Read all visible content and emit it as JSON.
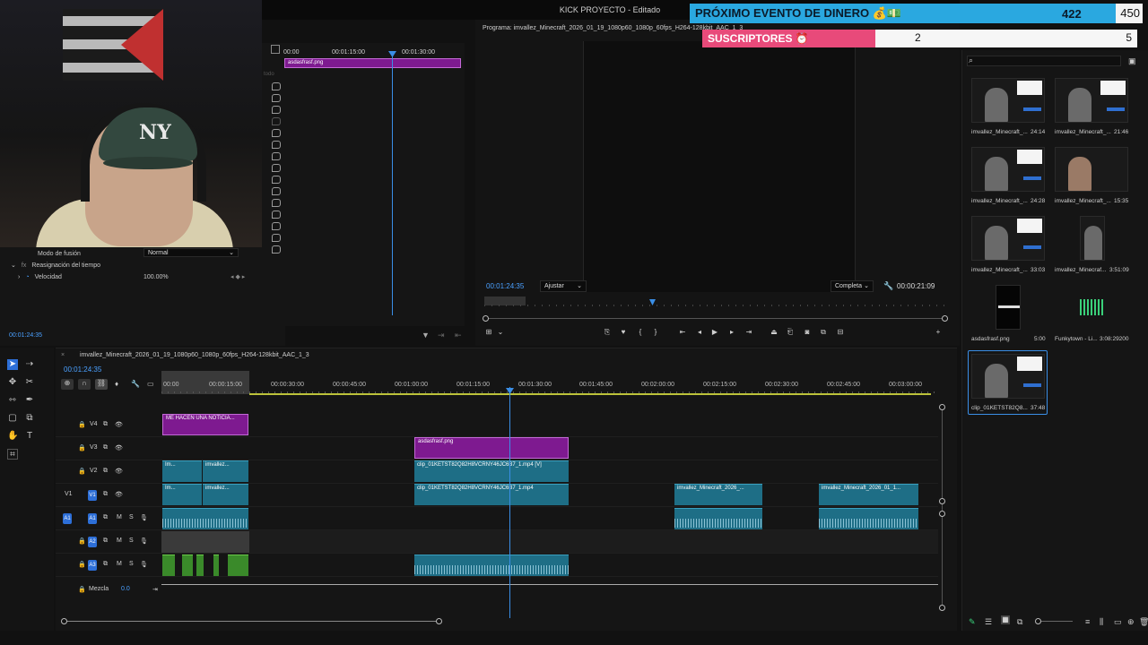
{
  "title": "KICK PROYECTO - Editado",
  "overlay": {
    "event_label": "PRÓXIMO EVENTO DE DINERO 💰💵",
    "event_count": "422",
    "event_goal": "450",
    "subs_label": "SUSCRIPTORES ⏰",
    "subs_count": "2",
    "subs_goal": "5"
  },
  "effect_controls": {
    "blend_label": "Modo de fusión",
    "blend_value": "Normal",
    "time_remap_label": "Reasignación del tiempo",
    "speed_label": "Velocidad",
    "speed_value": "100.00%",
    "timecode": "00:01:24:35"
  },
  "source": {
    "ruler": [
      "00:00",
      "00:01:15:00",
      "00:01:30:00"
    ],
    "clip_label": "asdasfrasf.png",
    "side_label": "todo"
  },
  "program": {
    "label": "Programa: imvallez_Minecraft_2026_01_19_1080p60_1080p_60fps_H264-128kbit_AAC_1_3",
    "timecode": "00:01:24:35",
    "fit_label": "Ajustar",
    "quality_label": "Completa",
    "duration": "00:00:21:09"
  },
  "bin": {
    "items": [
      {
        "name": "imvallez_Minecraft_...",
        "duration": "24:14"
      },
      {
        "name": "imvallez_Minecraft_...",
        "duration": "21:46"
      },
      {
        "name": "imvallez_Minecraft_...",
        "duration": "24:28"
      },
      {
        "name": "imvallez_Minecraft_...",
        "duration": "15:35"
      },
      {
        "name": "imvallez_Minecraft_...",
        "duration": "33:03"
      },
      {
        "name": "imvallez_Minecraf...",
        "duration": "3:51:09"
      },
      {
        "name": "asdasfrasf.png",
        "duration": "5:00"
      },
      {
        "name": "Funkytown - Li...",
        "duration": "3:08:29200"
      },
      {
        "name": "clip_01KETST82Q8...",
        "duration": "37:48"
      }
    ]
  },
  "timeline": {
    "sequence_name": "imvallez_Minecraft_2026_01_19_1080p60_1080p_60fps_H264-128kbit_AAC_1_3",
    "timecode": "00:01:24:35",
    "ruler": [
      "00:00",
      "00:00:15:00",
      "00:00:30:00",
      "00:00:45:00",
      "00:01:00:00",
      "00:01:15:00",
      "00:01:30:00",
      "00:01:45:00",
      "00:02:00:00",
      "00:02:15:00",
      "00:02:30:00",
      "00:02:45:00",
      "00:03:00:00"
    ],
    "tracks": {
      "v4": "V4",
      "v3": "V3",
      "v2": "V2",
      "v1": "V1",
      "v1_src": "V1",
      "a1": "A1",
      "a1_src": "A1",
      "a2": "A2",
      "a3": "A3",
      "m": "M",
      "s": "S",
      "mix_label": "Mezcla",
      "mix_value": "0.0"
    },
    "clips": {
      "v4_title": "ME HACEN UNA NOTICIA...",
      "v3_png": "asdasfrasf.png",
      "v2_a": "Im...",
      "v2_b": "imvallez...",
      "v2_clip": "clip_01KETST82Q82H8VCRNY46JC6B7_1.mp4 [V]",
      "v1_a": "Im...",
      "v1_b": "imvallez...",
      "v1_clip": "clip_01KETST82Q82H8VCRNY46JC6B7_1.mp4",
      "v1_c": "imvallez_Minecraft_2026_...",
      "v1_d": "imvallez_Minecraft_2026_01_1..."
    }
  }
}
